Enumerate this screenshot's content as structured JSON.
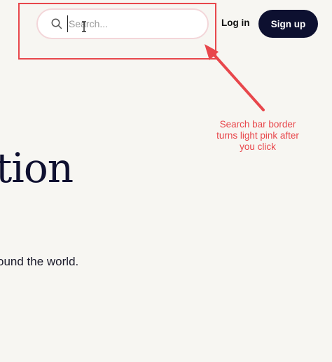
{
  "header": {
    "search": {
      "placeholder": "Search...",
      "icon": "search-icon"
    },
    "login_label": "Log in",
    "signup_label": "Sign up"
  },
  "hero": {
    "title_fragment": "tion",
    "subtitle_fragment": "ound the world."
  },
  "annotation": {
    "note": "Search bar border turns light pink after you click"
  },
  "colors": {
    "background": "#f7f6f2",
    "search_border": "#f3d6d9",
    "signup_bg": "#0d1030",
    "annotation_red": "#e8474c",
    "text_dark": "#0f1030"
  }
}
